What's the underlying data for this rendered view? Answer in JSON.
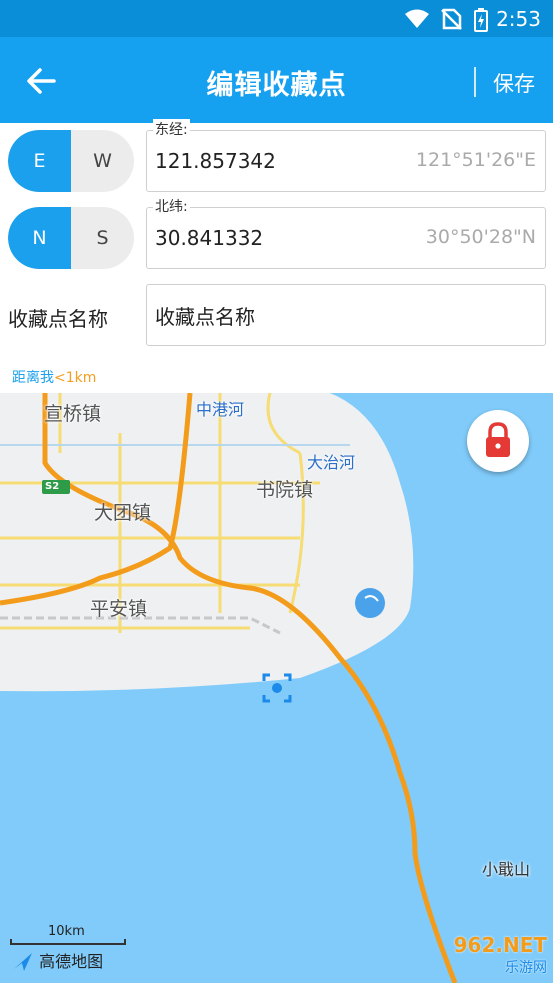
{
  "status_bar": {
    "time": "2:53"
  },
  "app_bar": {
    "title": "编辑收藏点",
    "save_label": "保存"
  },
  "longitude": {
    "label": "东经:",
    "value": "121.857342",
    "dms": "121°51'26\"E",
    "toggle": [
      "E",
      "W"
    ],
    "selected": "E"
  },
  "latitude": {
    "label": "北纬:",
    "value": "30.841332",
    "dms": "30°50'28\"N",
    "toggle": [
      "N",
      "S"
    ],
    "selected": "N"
  },
  "name": {
    "label": "收藏点名称",
    "placeholder": "收藏点名称"
  },
  "distance": {
    "prefix": "距离我",
    "value": "<1km"
  },
  "map": {
    "labels": {
      "xuanqiao": "宣桥镇",
      "zhonggang": "中港河",
      "dazhi": "大治河",
      "shuyuan": "书院镇",
      "datuan": "大团镇",
      "pingan": "平安镇",
      "xiaoqushan": "小戢山",
      "road_badge": "S2"
    },
    "scale": "10km",
    "logo": "高德地图",
    "watermark_top": "962.NET",
    "watermark_bottom": "乐游网"
  },
  "colors": {
    "app_bar": "#16a0f0",
    "accent": "#1ba0ee",
    "road": "#f0a020",
    "water": "#80cbfa",
    "land": "#eef0f2"
  }
}
